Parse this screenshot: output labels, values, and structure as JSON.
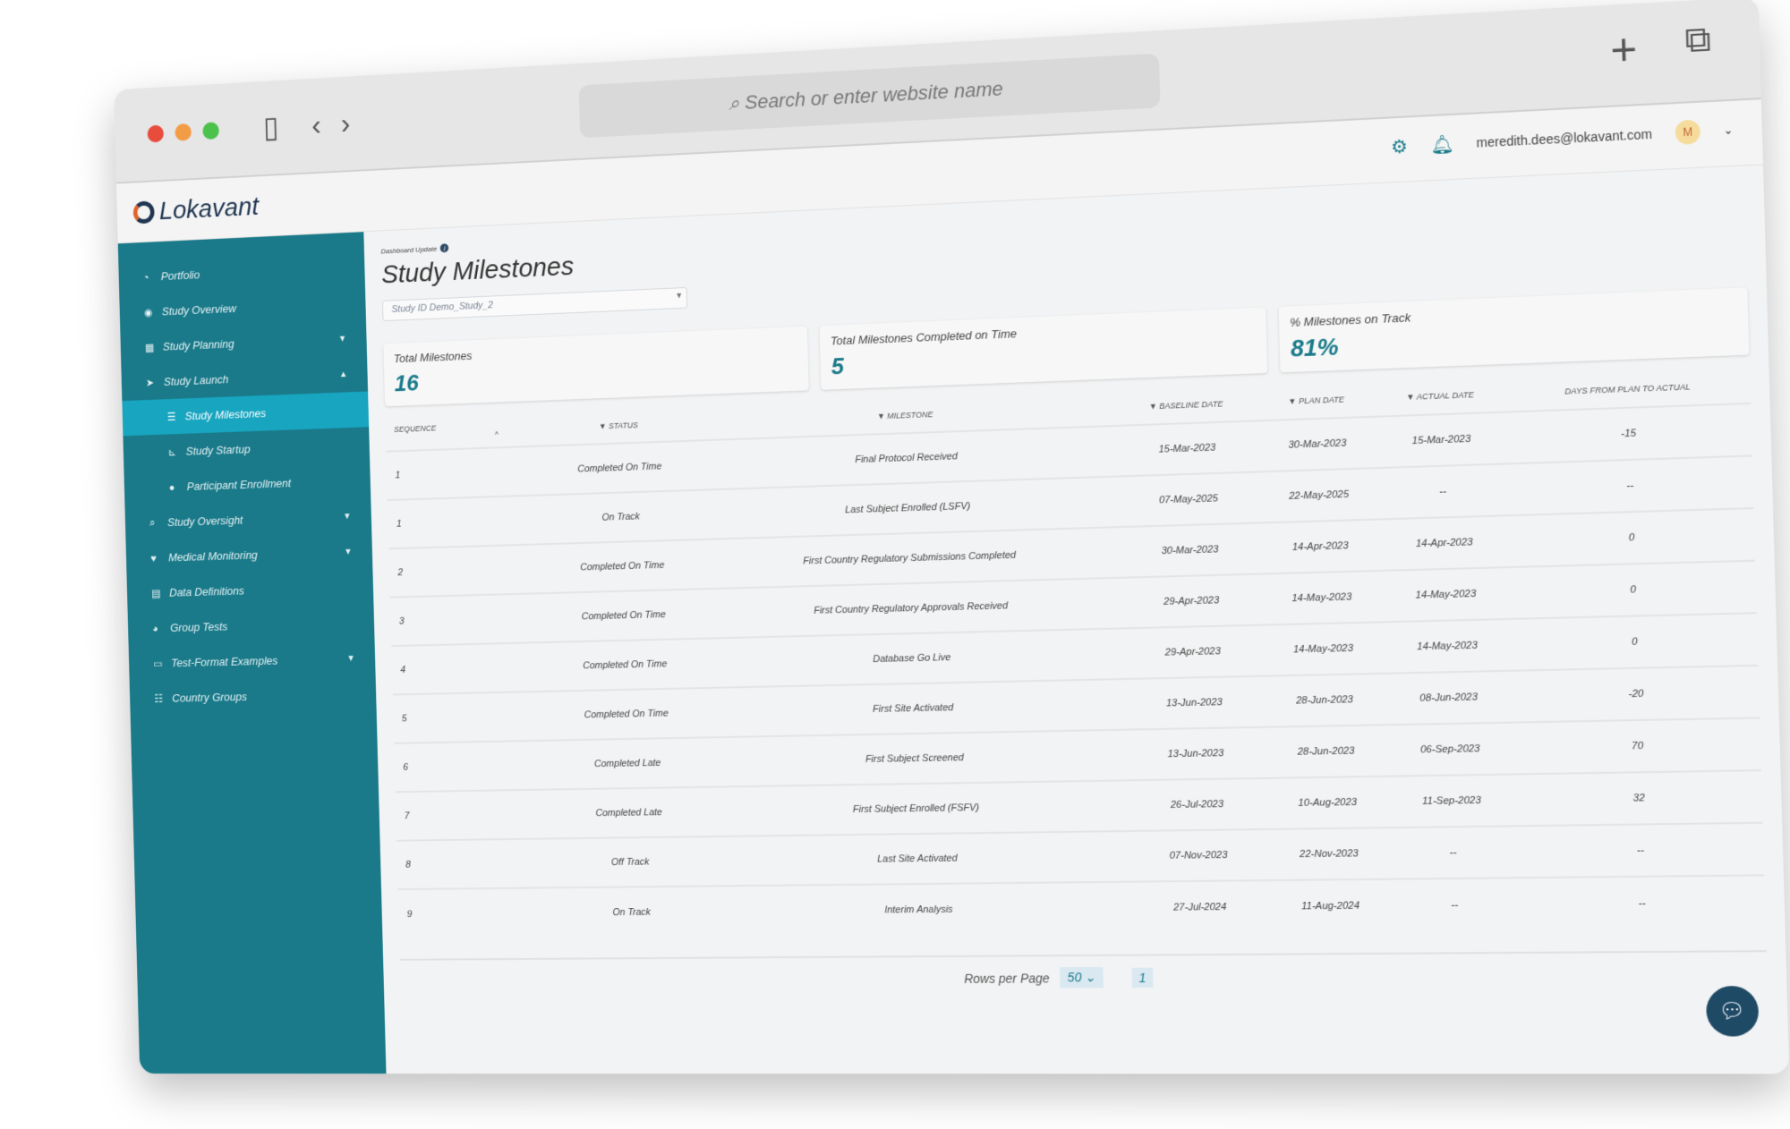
{
  "browser": {
    "url_placeholder": "Search or enter website name",
    "new_tab": "+",
    "tabs_icon": "⧉",
    "back": "‹",
    "forward": "›",
    "sidebar_icon": "▯"
  },
  "header": {
    "logo": "Lokavant",
    "email": "meredith.dees@lokavant.com",
    "avatar": "M"
  },
  "sidebar": {
    "items": [
      {
        "label": "Portfolio",
        "icon": "◔",
        "level": 0
      },
      {
        "label": "Study Overview",
        "icon": "◉",
        "level": 0
      },
      {
        "label": "Study Planning",
        "icon": "▦",
        "level": 0,
        "caret": "▼"
      },
      {
        "label": "Study Launch",
        "icon": "➤",
        "level": 0,
        "caret": "▲"
      },
      {
        "label": "Study Milestones",
        "icon": "☰",
        "level": 1,
        "active": true
      },
      {
        "label": "Study Startup",
        "icon": "⊾",
        "level": 1
      },
      {
        "label": "Participant Enrollment",
        "icon": "●",
        "level": 1
      },
      {
        "label": "Study Oversight",
        "icon": "⌕",
        "level": 0,
        "caret": "▼"
      },
      {
        "label": "Medical Monitoring",
        "icon": "♥",
        "level": 0,
        "caret": "▼"
      },
      {
        "label": "Data Definitions",
        "icon": "▤",
        "level": 0
      },
      {
        "label": "Group Tests",
        "icon": "◕",
        "level": 0
      },
      {
        "label": "Test-Format Examples",
        "icon": "▭",
        "level": 0,
        "caret": "▼"
      },
      {
        "label": "Country Groups",
        "icon": "☷",
        "level": 0
      }
    ]
  },
  "main": {
    "update_label": "Dashboard Update",
    "title": "Study Milestones",
    "study_select": "Study ID Demo_Study_2",
    "cards": [
      {
        "label": "Total Milestones",
        "value": "16"
      },
      {
        "label": "Total Milestones Completed on Time",
        "value": "5"
      },
      {
        "label": "% Milestones on Track",
        "value": "81%"
      }
    ],
    "columns": [
      "Sequence",
      "▼ Status",
      "▼ Milestone",
      "▼ Baseline Date",
      "▼ Plan Date",
      "▼ Actual Date",
      "Days from Plan to Actual"
    ],
    "sort_indicator": "^",
    "rows": [
      [
        "1",
        "Completed On Time",
        "Final Protocol Received",
        "15-Mar-2023",
        "30-Mar-2023",
        "15-Mar-2023",
        "-15"
      ],
      [
        "1",
        "On Track",
        "Last Subject Enrolled (LSFV)",
        "07-May-2025",
        "22-May-2025",
        "--",
        "--"
      ],
      [
        "2",
        "Completed On Time",
        "First Country Regulatory Submissions Completed",
        "30-Mar-2023",
        "14-Apr-2023",
        "14-Apr-2023",
        "0"
      ],
      [
        "3",
        "Completed On Time",
        "First Country Regulatory Approvals Received",
        "29-Apr-2023",
        "14-May-2023",
        "14-May-2023",
        "0"
      ],
      [
        "4",
        "Completed On Time",
        "Database Go Live",
        "29-Apr-2023",
        "14-May-2023",
        "14-May-2023",
        "0"
      ],
      [
        "5",
        "Completed On Time",
        "First Site Activated",
        "13-Jun-2023",
        "28-Jun-2023",
        "08-Jun-2023",
        "-20"
      ],
      [
        "6",
        "Completed Late",
        "First Subject Screened",
        "13-Jun-2023",
        "28-Jun-2023",
        "06-Sep-2023",
        "70"
      ],
      [
        "7",
        "Completed Late",
        "First Subject Enrolled (FSFV)",
        "26-Jul-2023",
        "10-Aug-2023",
        "11-Sep-2023",
        "32"
      ],
      [
        "8",
        "Off Track",
        "Last Site Activated",
        "07-Nov-2023",
        "22-Nov-2023",
        "--",
        "--"
      ],
      [
        "9",
        "On Track",
        "Interim Analysis",
        "27-Jul-2024",
        "11-Aug-2024",
        "--",
        "--"
      ]
    ],
    "pager": {
      "label": "Rows per Page",
      "value": "50",
      "page": "1"
    }
  },
  "colors": {
    "brand": "#1a7a8a",
    "active": "#17a5c0"
  }
}
